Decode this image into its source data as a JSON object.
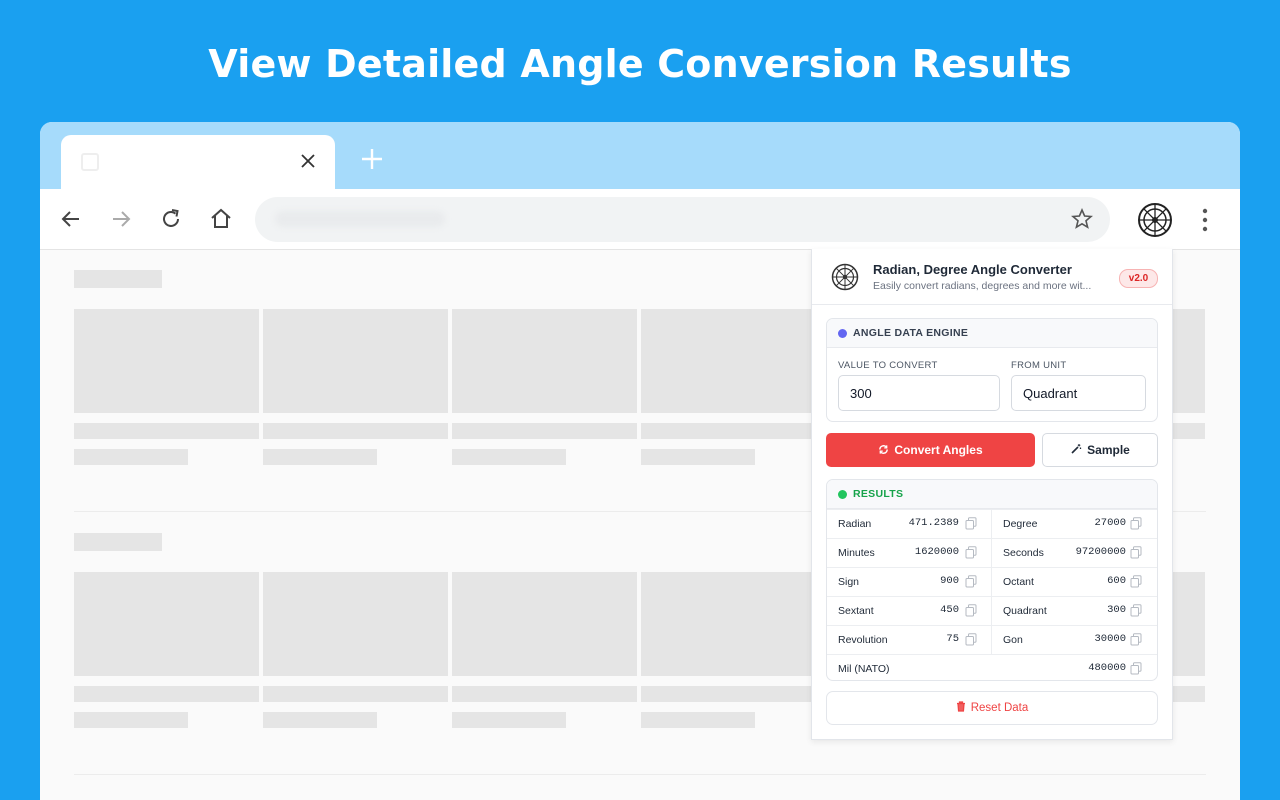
{
  "headline": "View Detailed Angle Conversion Results",
  "popup": {
    "title": "Radian, Degree Angle Converter",
    "subtitle": "Easily convert radians, degrees and more wit...",
    "version": "v2.0",
    "engine": {
      "title": "ANGLE DATA ENGINE",
      "value_label": "VALUE TO CONVERT",
      "value": "300",
      "unit_label": "FROM UNIT",
      "unit": "Quadrant"
    },
    "convert_label": "Convert Angles",
    "sample_label": "Sample",
    "results": {
      "title": "RESULTS",
      "rows": [
        [
          {
            "name": "Radian",
            "value": "471.2389"
          },
          {
            "name": "Degree",
            "value": "27000"
          }
        ],
        [
          {
            "name": "Minutes",
            "value": "1620000"
          },
          {
            "name": "Seconds",
            "value": "97200000"
          }
        ],
        [
          {
            "name": "Sign",
            "value": "900"
          },
          {
            "name": "Octant",
            "value": "600"
          }
        ],
        [
          {
            "name": "Sextant",
            "value": "450"
          },
          {
            "name": "Quadrant",
            "value": "300"
          }
        ],
        [
          {
            "name": "Revolution",
            "value": "75"
          },
          {
            "name": "Gon",
            "value": "30000"
          }
        ]
      ],
      "last": {
        "name": "Mil (NATO)",
        "value": "480000"
      }
    },
    "reset_label": "Reset Data"
  },
  "colors": {
    "background": "#1aa0f0",
    "tabbar": "#a6dbfb",
    "accent_red": "#ef4444",
    "engine_dot": "#6366f1",
    "results_dot": "#22c55e"
  },
  "icons": [
    "close-icon",
    "plus-icon",
    "back-arrow-icon",
    "forward-arrow-icon",
    "reload-icon",
    "home-icon",
    "star-icon",
    "extension-wheel-icon",
    "more-vert-icon",
    "refresh-icon",
    "magic-wand-icon",
    "copy-icon",
    "trash-icon"
  ]
}
